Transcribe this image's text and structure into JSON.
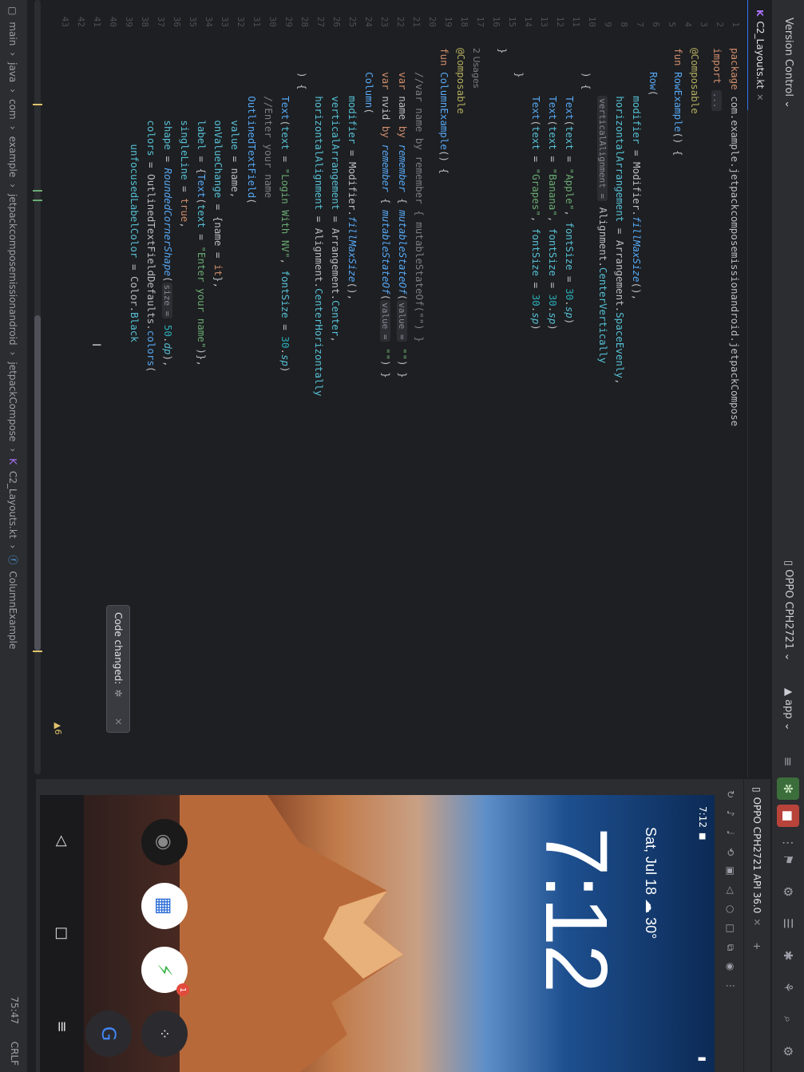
{
  "topbar": {
    "version_control": "Version Control",
    "device": "OPPO CPH2721",
    "app": "app"
  },
  "tab": {
    "filename": "C2_Layouts.kt"
  },
  "editor": {
    "gutter_numbers": [
      "1",
      "2",
      "3",
      "4",
      "5",
      "6",
      "7",
      "8",
      "9",
      "10",
      "11",
      "12",
      "13",
      "14",
      "15",
      "16",
      "17",
      "18",
      "19",
      "20",
      "21",
      "22",
      "23",
      "24",
      "25",
      "26",
      "27",
      "28",
      "29",
      "30",
      "31",
      "32",
      "33",
      "34",
      "35",
      "36",
      "37",
      "38",
      "39",
      "40",
      "41",
      "42",
      "43"
    ],
    "usages": "2 Usages",
    "warnings": "6"
  },
  "notification": {
    "text": "Code changed:"
  },
  "emulator": {
    "tab_label": "OPPO CPH2721 API 36.0",
    "time": "7:12",
    "date": "Sat, Jul 18",
    "weather": "30°",
    "badge_count": "1"
  },
  "status": {
    "crumbs": [
      "main",
      "java",
      "com",
      "example",
      "jetpackcomposemissionandroid",
      "jetpackCompose",
      "C2_Layouts.kt",
      "ColumnExample"
    ],
    "position": "75:47",
    "line_ending": "CRLF"
  }
}
